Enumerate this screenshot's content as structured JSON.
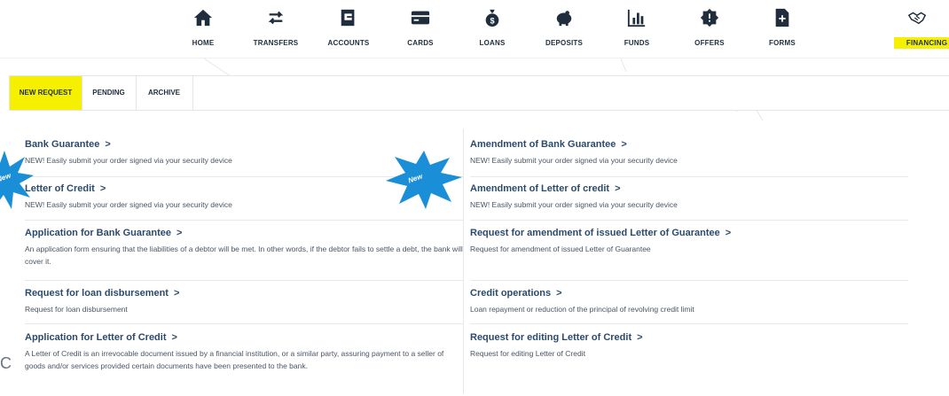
{
  "nav": {
    "items": [
      {
        "label": "HOME",
        "icon": "home-icon"
      },
      {
        "label": "TRANSFERS",
        "icon": "transfer-arrows-icon"
      },
      {
        "label": "ACCOUNTS",
        "icon": "accounts-icon"
      },
      {
        "label": "CARDS",
        "icon": "card-icon"
      },
      {
        "label": "LOANS",
        "icon": "money-bag-icon"
      },
      {
        "label": "DEPOSITS",
        "icon": "piggy-bank-icon"
      },
      {
        "label": "FUNDS",
        "icon": "bar-chart-icon"
      },
      {
        "label": "OFFERS",
        "icon": "offer-badge-icon"
      },
      {
        "label": "FORMS",
        "icon": "form-plus-icon"
      },
      {
        "label": "FINANCING",
        "icon": "handshake-icon"
      }
    ],
    "active": "FINANCING",
    "accent_color": "#f5f000"
  },
  "tabs": {
    "items": [
      {
        "label": "NEW REQUEST"
      },
      {
        "label": "PENDING"
      },
      {
        "label": "ARCHIVE"
      }
    ],
    "active": "NEW REQUEST"
  },
  "badges": {
    "new_label": "New",
    "color": "#1a8fd8"
  },
  "left_items": [
    {
      "title": "Bank Guarantee",
      "chevron": ">",
      "desc": "NEW! Easily submit your order signed via your security device"
    },
    {
      "title": "Letter of Credit",
      "chevron": ">",
      "desc": "NEW! Easily submit your order signed via your security device"
    },
    {
      "title": "Application for Bank Guarantee",
      "chevron": ">",
      "desc": "An application form ensuring that the liabilities of a debtor will be met. In other words, if the debtor fails to settle a debt, the bank will cover it."
    },
    {
      "title": "Request for loan disbursement",
      "chevron": ">",
      "desc": "Request for loan disbursement"
    },
    {
      "title": "Application for Letter of Credit",
      "chevron": ">",
      "desc": "A Letter of Credit is an irrevocable document issued by a financial institution, or a similar party, assuring payment to a seller of goods and/or services provided certain documents have been presented to the bank."
    }
  ],
  "right_items": [
    {
      "title": "Amendment of Bank Guarantee",
      "chevron": ">",
      "desc": "NEW! Easily submit your order signed via your security device"
    },
    {
      "title": "Amendment of Letter of credit",
      "chevron": ">",
      "desc": "NEW! Easily submit your order signed via your security device"
    },
    {
      "title": "Request for amendment of issued Letter of Guarantee",
      "chevron": ">",
      "desc": "Request for amendment of issued Letter of Guarantee"
    },
    {
      "title": "Credit operations",
      "chevron": ">",
      "desc": "Loan repayment or reduction of the principal of revolving credit limit"
    },
    {
      "title": "Request for editing Letter of Credit",
      "chevron": ">",
      "desc": "Request for editing Letter of Credit"
    }
  ]
}
